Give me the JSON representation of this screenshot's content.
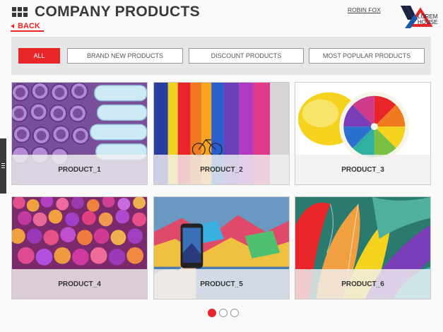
{
  "header": {
    "title": "COMPANY PRODUCTS",
    "back_label": "BACK",
    "user_name": "ROBIN FOX",
    "logo_text_line1": "LOREM",
    "logo_text_line2": "HOUSE"
  },
  "filters": [
    {
      "label": "ALL",
      "active": true
    },
    {
      "label": "BRAND NEW PRODUCTS",
      "active": false
    },
    {
      "label": "DISCOUNT PRODUCTS",
      "active": false
    },
    {
      "label": "MOST POPULAR PRODUCTS",
      "active": false
    }
  ],
  "products": [
    {
      "label": "PRODUCT_1",
      "image": "purple-pipes"
    },
    {
      "label": "PRODUCT_2",
      "image": "colorful-columns"
    },
    {
      "label": "PRODUCT_3",
      "image": "rainbow-lemon"
    },
    {
      "label": "PRODUCT_4",
      "image": "colored-balls"
    },
    {
      "label": "PRODUCT_5",
      "image": "phone-graffiti"
    },
    {
      "label": "PRODUCT_6",
      "image": "feathers"
    }
  ],
  "pagination": {
    "pages": 3,
    "current": 1
  },
  "colors": {
    "accent": "#e8262a",
    "dark": "#3a3a3a"
  }
}
